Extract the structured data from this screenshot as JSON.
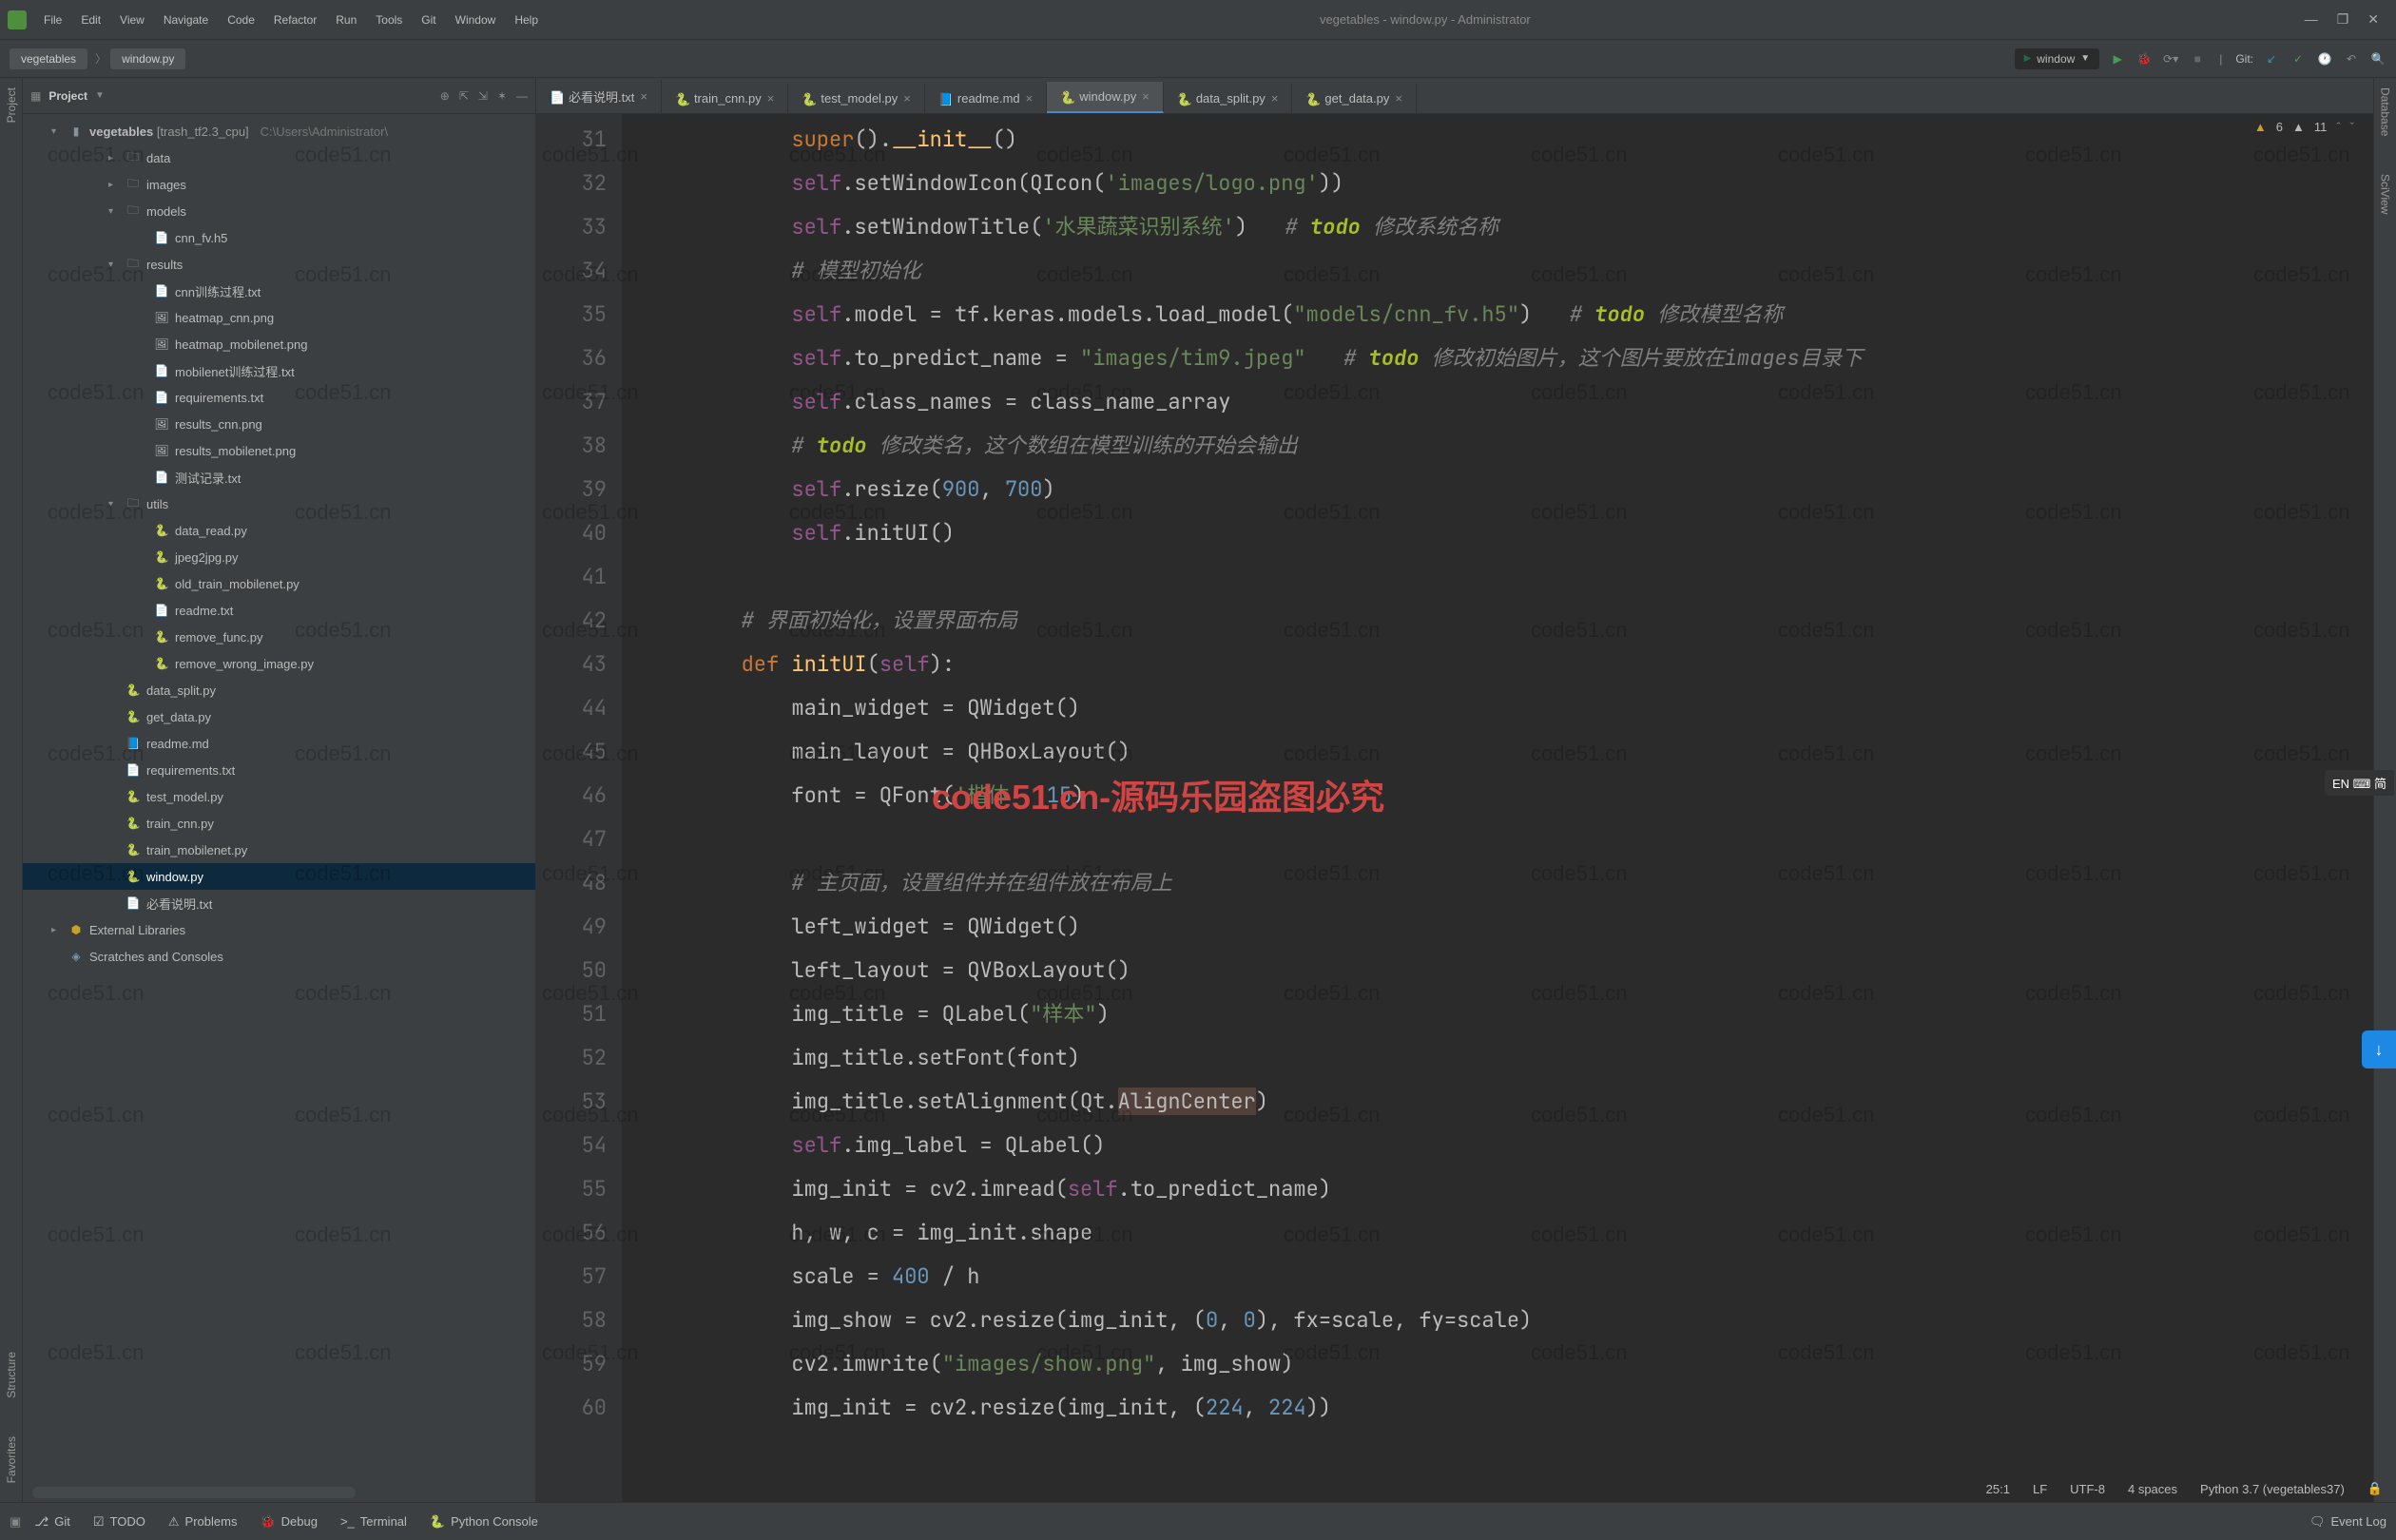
{
  "window_title": "vegetables - window.py - Administrator",
  "menu": [
    "File",
    "Edit",
    "View",
    "Navigate",
    "Code",
    "Refactor",
    "Run",
    "Tools",
    "Git",
    "Window",
    "Help"
  ],
  "breadcrumbs": [
    "vegetables",
    "window.py"
  ],
  "run_config": "window",
  "git_label": "Git:",
  "project_panel": {
    "title": "Project",
    "root_project": "vegetables",
    "root_suffix": "[trash_tf2.3_cpu]",
    "root_path": "C:\\Users\\Administrator\\",
    "tree": [
      {
        "type": "folder",
        "name": "data",
        "indent": 2,
        "expanded": false
      },
      {
        "type": "folder",
        "name": "images",
        "indent": 2,
        "expanded": false
      },
      {
        "type": "folder",
        "name": "models",
        "indent": 2,
        "expanded": true
      },
      {
        "type": "file",
        "name": "cnn_fv.h5",
        "indent": 3,
        "icon": "txt"
      },
      {
        "type": "folder",
        "name": "results",
        "indent": 2,
        "expanded": true
      },
      {
        "type": "file",
        "name": "cnn训练过程.txt",
        "indent": 3,
        "icon": "txt"
      },
      {
        "type": "file",
        "name": "heatmap_cnn.png",
        "indent": 3,
        "icon": "img"
      },
      {
        "type": "file",
        "name": "heatmap_mobilenet.png",
        "indent": 3,
        "icon": "img"
      },
      {
        "type": "file",
        "name": "mobilenet训练过程.txt",
        "indent": 3,
        "icon": "txt"
      },
      {
        "type": "file",
        "name": "requirements.txt",
        "indent": 3,
        "icon": "txt"
      },
      {
        "type": "file",
        "name": "results_cnn.png",
        "indent": 3,
        "icon": "img"
      },
      {
        "type": "file",
        "name": "results_mobilenet.png",
        "indent": 3,
        "icon": "img"
      },
      {
        "type": "file",
        "name": "测试记录.txt",
        "indent": 3,
        "icon": "txt"
      },
      {
        "type": "folder",
        "name": "utils",
        "indent": 2,
        "expanded": true
      },
      {
        "type": "file",
        "name": "data_read.py",
        "indent": 3,
        "icon": "py"
      },
      {
        "type": "file",
        "name": "jpeg2jpg.py",
        "indent": 3,
        "icon": "py"
      },
      {
        "type": "file",
        "name": "old_train_mobilenet.py",
        "indent": 3,
        "icon": "py"
      },
      {
        "type": "file",
        "name": "readme.txt",
        "indent": 3,
        "icon": "txt"
      },
      {
        "type": "file",
        "name": "remove_func.py",
        "indent": 3,
        "icon": "py"
      },
      {
        "type": "file",
        "name": "remove_wrong_image.py",
        "indent": 3,
        "icon": "py"
      },
      {
        "type": "file",
        "name": "data_split.py",
        "indent": 2,
        "icon": "py"
      },
      {
        "type": "file",
        "name": "get_data.py",
        "indent": 2,
        "icon": "py"
      },
      {
        "type": "file",
        "name": "readme.md",
        "indent": 2,
        "icon": "md"
      },
      {
        "type": "file",
        "name": "requirements.txt",
        "indent": 2,
        "icon": "txt"
      },
      {
        "type": "file",
        "name": "test_model.py",
        "indent": 2,
        "icon": "py"
      },
      {
        "type": "file",
        "name": "train_cnn.py",
        "indent": 2,
        "icon": "py"
      },
      {
        "type": "file",
        "name": "train_mobilenet.py",
        "indent": 2,
        "icon": "py"
      },
      {
        "type": "file",
        "name": "window.py",
        "indent": 2,
        "icon": "py",
        "selected": true
      },
      {
        "type": "file",
        "name": "必看说明.txt",
        "indent": 2,
        "icon": "txt"
      },
      {
        "type": "lib",
        "name": "External Libraries",
        "indent": 0
      },
      {
        "type": "scratch",
        "name": "Scratches and Consoles",
        "indent": 0
      }
    ]
  },
  "editor_tabs": [
    {
      "name": "必看说明.txt",
      "icon": "txt"
    },
    {
      "name": "train_cnn.py",
      "icon": "py"
    },
    {
      "name": "test_model.py",
      "icon": "py"
    },
    {
      "name": "readme.md",
      "icon": "md"
    },
    {
      "name": "window.py",
      "icon": "py",
      "active": true
    },
    {
      "name": "data_split.py",
      "icon": "py"
    },
    {
      "name": "get_data.py",
      "icon": "py"
    }
  ],
  "warnings": {
    "yellow": "6",
    "weak": "11"
  },
  "code_lines": [
    {
      "n": 31,
      "html": "            <span class='kw'>super</span>().<span class='fn'>__init__</span>()"
    },
    {
      "n": 32,
      "html": "            <span class='self'>self</span>.setWindowIcon(QIcon(<span class='str'>'images/logo.png'</span>))"
    },
    {
      "n": 33,
      "html": "            <span class='self'>self</span>.setWindowTitle(<span class='str'>'水果蔬菜识别系统'</span>)   <span class='cmt'># <span class='todo'>todo</span> 修改系统名称</span>"
    },
    {
      "n": 34,
      "html": "            <span class='cmt'># 模型初始化</span>"
    },
    {
      "n": 35,
      "html": "            <span class='self'>self</span>.model = tf.keras.models.load_model(<span class='str'>\"models/cnn_fv.h5\"</span>)   <span class='cmt'># <span class='todo'>todo</span> 修改模型名称</span>"
    },
    {
      "n": 36,
      "html": "            <span class='self'>self</span>.to_predict_name = <span class='str'>\"images/tim9.jpeg\"</span>   <span class='cmt'># <span class='todo'>todo</span> 修改初始图片，这个图片要放在images目录下</span>"
    },
    {
      "n": 37,
      "html": "            <span class='self'>self</span>.class_names = class_name_array"
    },
    {
      "n": 38,
      "html": "            <span class='cmt'># <span class='todo'>todo</span> 修改类名，这个数组在模型训练的开始会输出</span>"
    },
    {
      "n": 39,
      "html": "            <span class='self'>self</span>.resize(<span class='num'>900</span>, <span class='num'>700</span>)"
    },
    {
      "n": 40,
      "html": "            <span class='self'>self</span>.initUI()"
    },
    {
      "n": 41,
      "html": ""
    },
    {
      "n": 42,
      "html": "        <span class='cmt'># 界面初始化，设置界面布局</span>"
    },
    {
      "n": 43,
      "html": "        <span class='kw'>def </span><span class='fn'>initUI</span>(<span class='self'>self</span>):"
    },
    {
      "n": 44,
      "html": "            main_widget = QWidget()"
    },
    {
      "n": 45,
      "html": "            main_layout = QHBoxLayout()"
    },
    {
      "n": 46,
      "html": "            font = QFont(<span class='str'>'楷体'</span>, <span class='num'>15</span>)"
    },
    {
      "n": 47,
      "html": ""
    },
    {
      "n": 48,
      "html": "            <span class='cmt'># 主页面，设置组件并在组件放在布局上</span>"
    },
    {
      "n": 49,
      "html": "            left_widget = QWidget()"
    },
    {
      "n": 50,
      "html": "            left_layout = QVBoxLayout()"
    },
    {
      "n": 51,
      "html": "            img_title = QLabel(<span class='str'>\"样本\"</span>)"
    },
    {
      "n": 52,
      "html": "            img_title.setFont(font)"
    },
    {
      "n": 53,
      "html": "            img_title.setAlignment(Qt.<span style='background:#52403a'>AlignCenter</span>)"
    },
    {
      "n": 54,
      "html": "            <span class='self'>self</span>.img_label = QLabel()"
    },
    {
      "n": 55,
      "html": "            img_init = cv2.imread(<span class='self'>self</span>.to_predict_name)"
    },
    {
      "n": 56,
      "html": "            h, w, c = img_init.shape"
    },
    {
      "n": 57,
      "html": "            scale = <span class='num'>400</span> / h"
    },
    {
      "n": 58,
      "html": "            img_show = cv2.resize(img_init, (<span class='num'>0</span>, <span class='num'>0</span>), fx=scale, fy=scale)"
    },
    {
      "n": 59,
      "html": "            cv2.imwrite(<span class='str'>\"images/show.png\"</span>, img_show)"
    },
    {
      "n": 60,
      "html": "            img_init = cv2.resize(img_init, (<span class='num'>224</span>, <span class='num'>224</span>))"
    }
  ],
  "watermark_text": "code51.cn",
  "watermark_red": "code51.cn-源码乐园盗图必究",
  "ime_badge": "EN ⌨ 简",
  "bottom_tools": [
    "Git",
    "TODO",
    "Problems",
    "Debug",
    "Terminal",
    "Python Console"
  ],
  "event_log": "Event Log",
  "status": {
    "pos": "25:1",
    "le": "LF",
    "enc": "UTF-8",
    "indent": "4 spaces",
    "interp": "Python 3.7 (vegetables37)"
  },
  "left_rail": [
    "Project",
    "Structure",
    "Favorites"
  ],
  "right_rail": [
    "Database",
    "SciView"
  ]
}
